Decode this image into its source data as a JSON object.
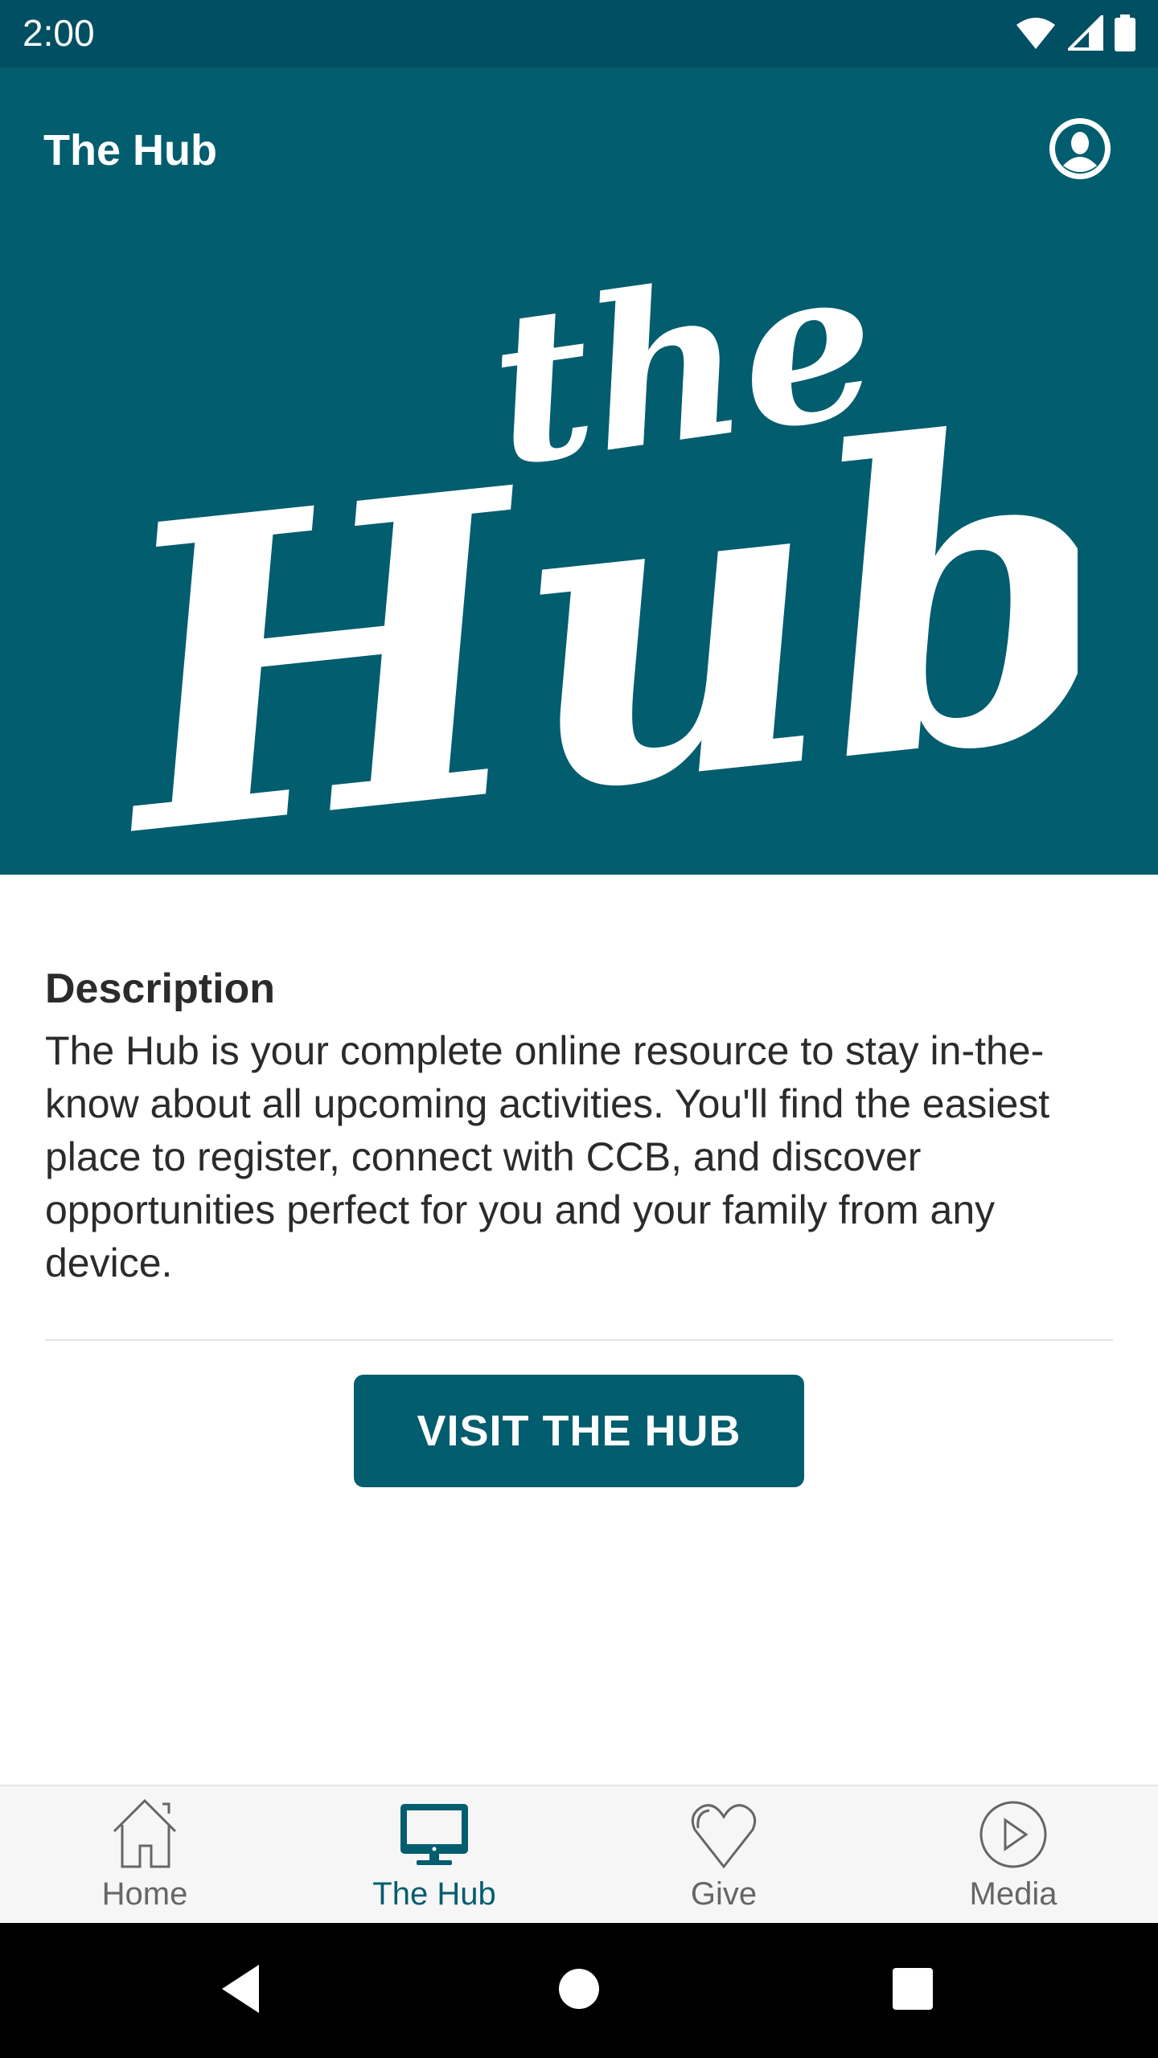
{
  "status_bar": {
    "time": "2:00",
    "icons": [
      "wifi-icon",
      "signal-icon",
      "battery-icon"
    ]
  },
  "app_bar": {
    "title": "The Hub",
    "profile_icon": "account-circle-icon",
    "logo_text_small": "the",
    "logo_text_large": "Hub"
  },
  "content": {
    "heading": "Description",
    "body": "The Hub is your complete online resource to stay in-the-know about all upcoming activities. You'll find the easiest place to register, connect with CCB, and discover opportunities perfect for you and your family from any device.",
    "button_label": "VISIT THE HUB"
  },
  "bottom_nav": {
    "items": [
      {
        "label": "Home",
        "icon": "home-icon",
        "active": false
      },
      {
        "label": "The Hub",
        "icon": "monitor-icon",
        "active": true
      },
      {
        "label": "Give",
        "icon": "heart-icon",
        "active": false
      },
      {
        "label": "Media",
        "icon": "play-circle-icon",
        "active": false
      }
    ]
  },
  "colors": {
    "brand": "#025d6e",
    "status_bar": "#004f62",
    "nav_inactive": "#666666",
    "text": "#2b2b2b"
  }
}
